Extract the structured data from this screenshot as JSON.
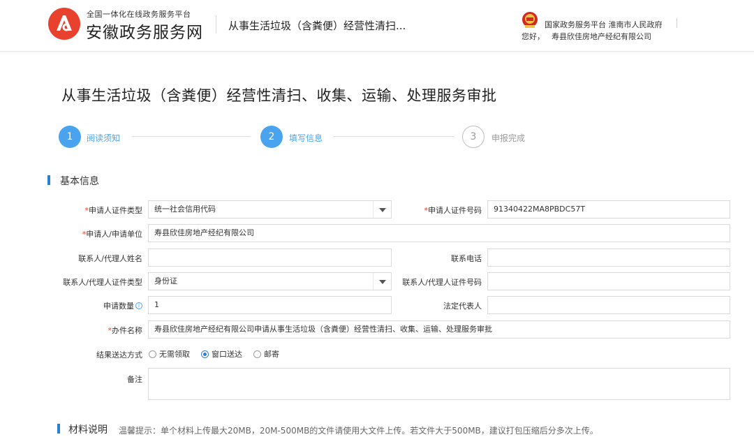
{
  "header": {
    "brand_small": "全国一体化在线政务服务平台",
    "brand_big": "安徽政务服务网",
    "service_name": "从事生活垃圾（含粪便）经营性清扫...",
    "platform": "国家政务服务平台 淮南市人民政府",
    "greeting": "您好，",
    "company": "寿县欣佳房地产经纪有限公司"
  },
  "title": "从事生活垃圾（含粪便）经营性清扫、收集、运输、处理服务审批",
  "steps": [
    {
      "number": "1",
      "label": "阅读须知",
      "state": "active"
    },
    {
      "number": "2",
      "label": "填写信息",
      "state": "active"
    },
    {
      "number": "3",
      "label": "申报完成",
      "state": "pending"
    }
  ],
  "basic_info": {
    "title": "基本信息",
    "required_mark": "*",
    "applicant_id_type": {
      "label": "申请人证件类型",
      "value": "统一社会信用代码"
    },
    "applicant_id_number": {
      "label": "申请人证件号码",
      "value": "91340422MA8PBDC57T"
    },
    "applicant_unit": {
      "label": "申请人/申请单位",
      "value": "寿县欣佳房地产经纪有限公司"
    },
    "contact_name": {
      "label": "联系人/代理人姓名",
      "value": ""
    },
    "contact_phone": {
      "label": "联系电话",
      "value": ""
    },
    "contact_id_type": {
      "label": "联系人/代理人证件类型",
      "value": "身份证"
    },
    "contact_id_number": {
      "label": "联系人/代理人证件号码",
      "value": ""
    },
    "quantity": {
      "label": "申请数量",
      "value": "1"
    },
    "legal_rep": {
      "label": "法定代表人",
      "value": ""
    },
    "case_name": {
      "label": "办件名称",
      "value": "寿县欣佳房地产经纪有限公司申请从事生活垃圾（含粪便）经营性清扫、收集、运输、处理服务审批"
    },
    "delivery": {
      "label": "结果送达方式",
      "options": [
        "无需领取",
        "窗口送达",
        "邮寄"
      ],
      "selected": "窗口送达"
    },
    "remark": {
      "label": "备注",
      "value": ""
    }
  },
  "materials": {
    "title": "材料说明",
    "hint": "温馨提示：单个材料上传最大20MB，20M-500MB的文件请使用大文件上传。若文件大于500MB，建议打包压缩后分多次上传。"
  },
  "colors": {
    "accent": "#4aa3ef",
    "section_bar": "#2d7fd3",
    "required": "#e8422f",
    "logo": "#e8422f"
  }
}
